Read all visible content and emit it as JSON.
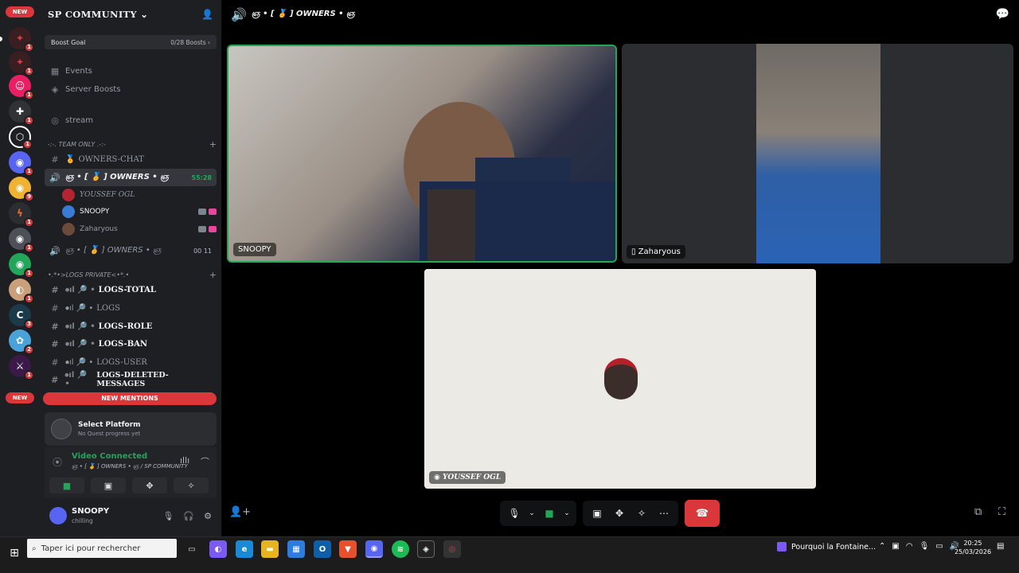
{
  "rail": {
    "new_top": "NEW",
    "new_bottom": "NEW"
  },
  "server": {
    "name": "SP COMMUNITY",
    "boost_label": "Boost Goal",
    "boost_count": "0/28 Boosts"
  },
  "nav": {
    "events": "Events",
    "server_boosts": "Server Boosts",
    "stream": "stream"
  },
  "team": {
    "category": "-:-. TEAM ONLY .-:-",
    "owners_chat": "OWNERS-CHAT",
    "voice_active": "ஞ • [ 🏅 ] OWNERS • ஞ",
    "voice_active_time": "55:28",
    "voice_users": [
      {
        "name": "YOUSSEF OGL"
      },
      {
        "name": "SNOOPY"
      },
      {
        "name": "Zaharyous"
      }
    ],
    "voice_second": "ஞ • [ 🏅 ] OWNERS • ஞ",
    "voice_second_counts": "00 11"
  },
  "logs": {
    "category": "•.*•>LOGS PRIVATE<•*.•",
    "channels": [
      "LOGS-TOTAL",
      "LOGS",
      "LOGS-ROLE",
      "LOGS-BAN",
      "LOGS-USER",
      "LOGS-DELETED-MESSAGES"
    ]
  },
  "new_mentions": "NEW MENTIONS",
  "quest": {
    "title": "Select Platform",
    "subtitle": "No Quest progress yet"
  },
  "voice_connection": {
    "status": "Video Connected",
    "channel": "ஞ • [ 🏅 ] OWNERS • ஞ / SP COMMUNITY"
  },
  "user": {
    "name": "SNOOPY",
    "status": "chilling"
  },
  "topbar": {
    "channel": "ஞ • [ 🏅 ] OWNERS • ஞ"
  },
  "tiles": {
    "snoopy": "SNOOPY",
    "zaharyous": "Zaharyous",
    "youssef": "YOUSSEF OGL"
  },
  "taskbar": {
    "search_placeholder": "Taper ici pour rechercher",
    "news": "Pourquoi la Fontaine...",
    "time": "20:25",
    "date": "25/03/2026"
  }
}
